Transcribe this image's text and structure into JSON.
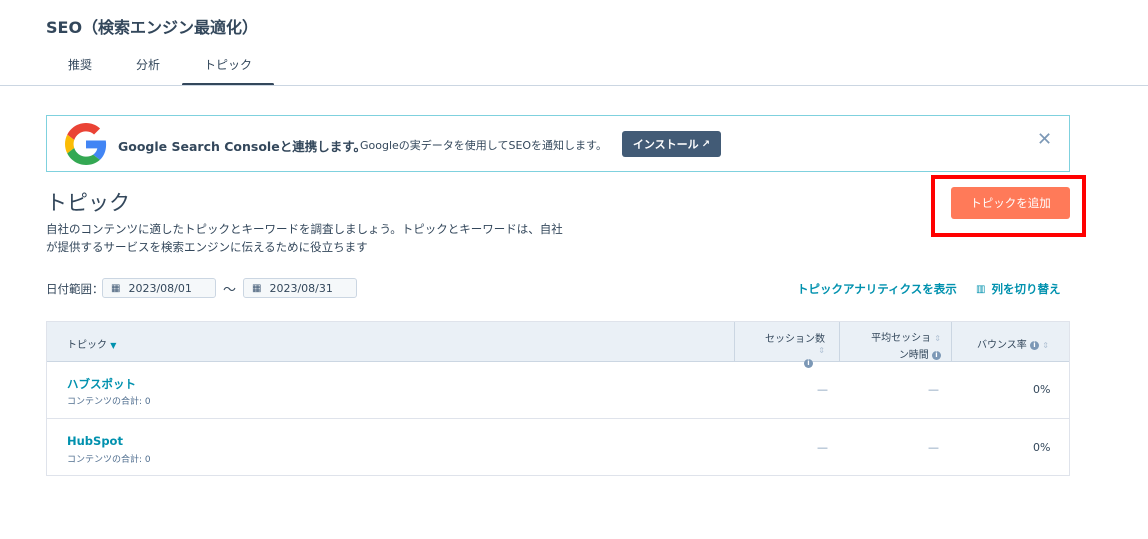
{
  "header": {
    "title": "SEO（検索エンジン最適化）",
    "tabs": [
      {
        "label": "推奨"
      },
      {
        "label": "分析"
      },
      {
        "label": "トピック"
      }
    ]
  },
  "banner": {
    "title": "Google Search Consoleと連携します。",
    "description": "Googleの実データを使用してSEOを通知します。",
    "install_label": "インストール",
    "close_glyph": "✕"
  },
  "section": {
    "title": "トピック",
    "description": "自社のコンテンツに適したトピックとキーワードを調査しましょう。トピックとキーワードは、自社が提供するサービスを検索エンジンに伝えるために役立ちます",
    "add_button": "トピックを追加"
  },
  "filters": {
    "date_label": "日付範囲：",
    "start_date": "2023/08/01",
    "separator": "～",
    "end_date": "2023/08/31",
    "analytics_link": "トピックアナリティクスを表示",
    "columns_link": "列を切り替え"
  },
  "table": {
    "columns": {
      "topic": "トピック",
      "sessions": "セッション数",
      "avg_session_line1": "平均セッショ",
      "avg_session_line2": "ン時間",
      "bounce": "バウンス率"
    },
    "rows": [
      {
        "name": "ハブスポット",
        "sub": "コンテンツの合計: 0",
        "sessions": "—",
        "avg_session": "—",
        "bounce": "0%"
      },
      {
        "name": "HubSpot",
        "sub": "コンテンツの合計: 0",
        "sessions": "—",
        "avg_session": "—",
        "bounce": "0%"
      }
    ]
  },
  "colors": {
    "accent": "#ff7a59",
    "link": "#0091ae",
    "highlight": "#ff0000",
    "dark_button": "#425b76"
  }
}
